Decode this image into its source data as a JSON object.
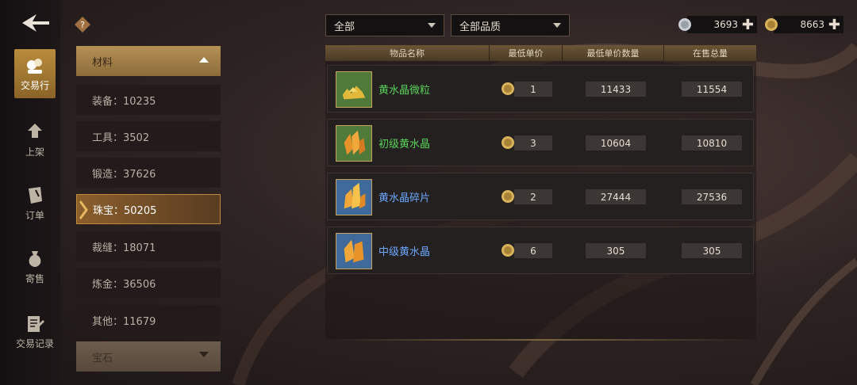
{
  "nav": {
    "items": [
      {
        "label": "交易行",
        "icon": "trade-icon"
      },
      {
        "label": "上架",
        "icon": "listing-icon"
      },
      {
        "label": "订单",
        "icon": "order-icon"
      },
      {
        "label": "寄售",
        "icon": "consign-icon"
      },
      {
        "label": "交易记录",
        "icon": "record-icon"
      }
    ]
  },
  "categories": {
    "header": "材料",
    "items": [
      {
        "label": "装备：10235"
      },
      {
        "label": "工具：3502"
      },
      {
        "label": "锻造：37626"
      },
      {
        "label": "珠宝：50205"
      },
      {
        "label": "裁缝：18071"
      },
      {
        "label": "炼金：36506"
      },
      {
        "label": "其他：11679"
      }
    ],
    "footer": "宝石"
  },
  "filters": {
    "type": "全部",
    "quality": "全部品质"
  },
  "currency": {
    "silver": "3693",
    "gold": "8663"
  },
  "table": {
    "headers": [
      "物品名称",
      "最低单价",
      "最低单价数量",
      "在售总量"
    ],
    "rows": [
      {
        "name": "黄水晶微粒",
        "price": "1",
        "qty": "11433",
        "total": "11554",
        "color": "#58d35a"
      },
      {
        "name": "初级黄水晶",
        "price": "3",
        "qty": "10604",
        "total": "10810",
        "color": "#58d35a"
      },
      {
        "name": "黄水晶碎片",
        "price": "2",
        "qty": "27444",
        "total": "27536",
        "color": "#6aa8ff"
      },
      {
        "name": "中级黄水晶",
        "price": "6",
        "qty": "305",
        "total": "305",
        "color": "#6aa8ff"
      }
    ]
  }
}
